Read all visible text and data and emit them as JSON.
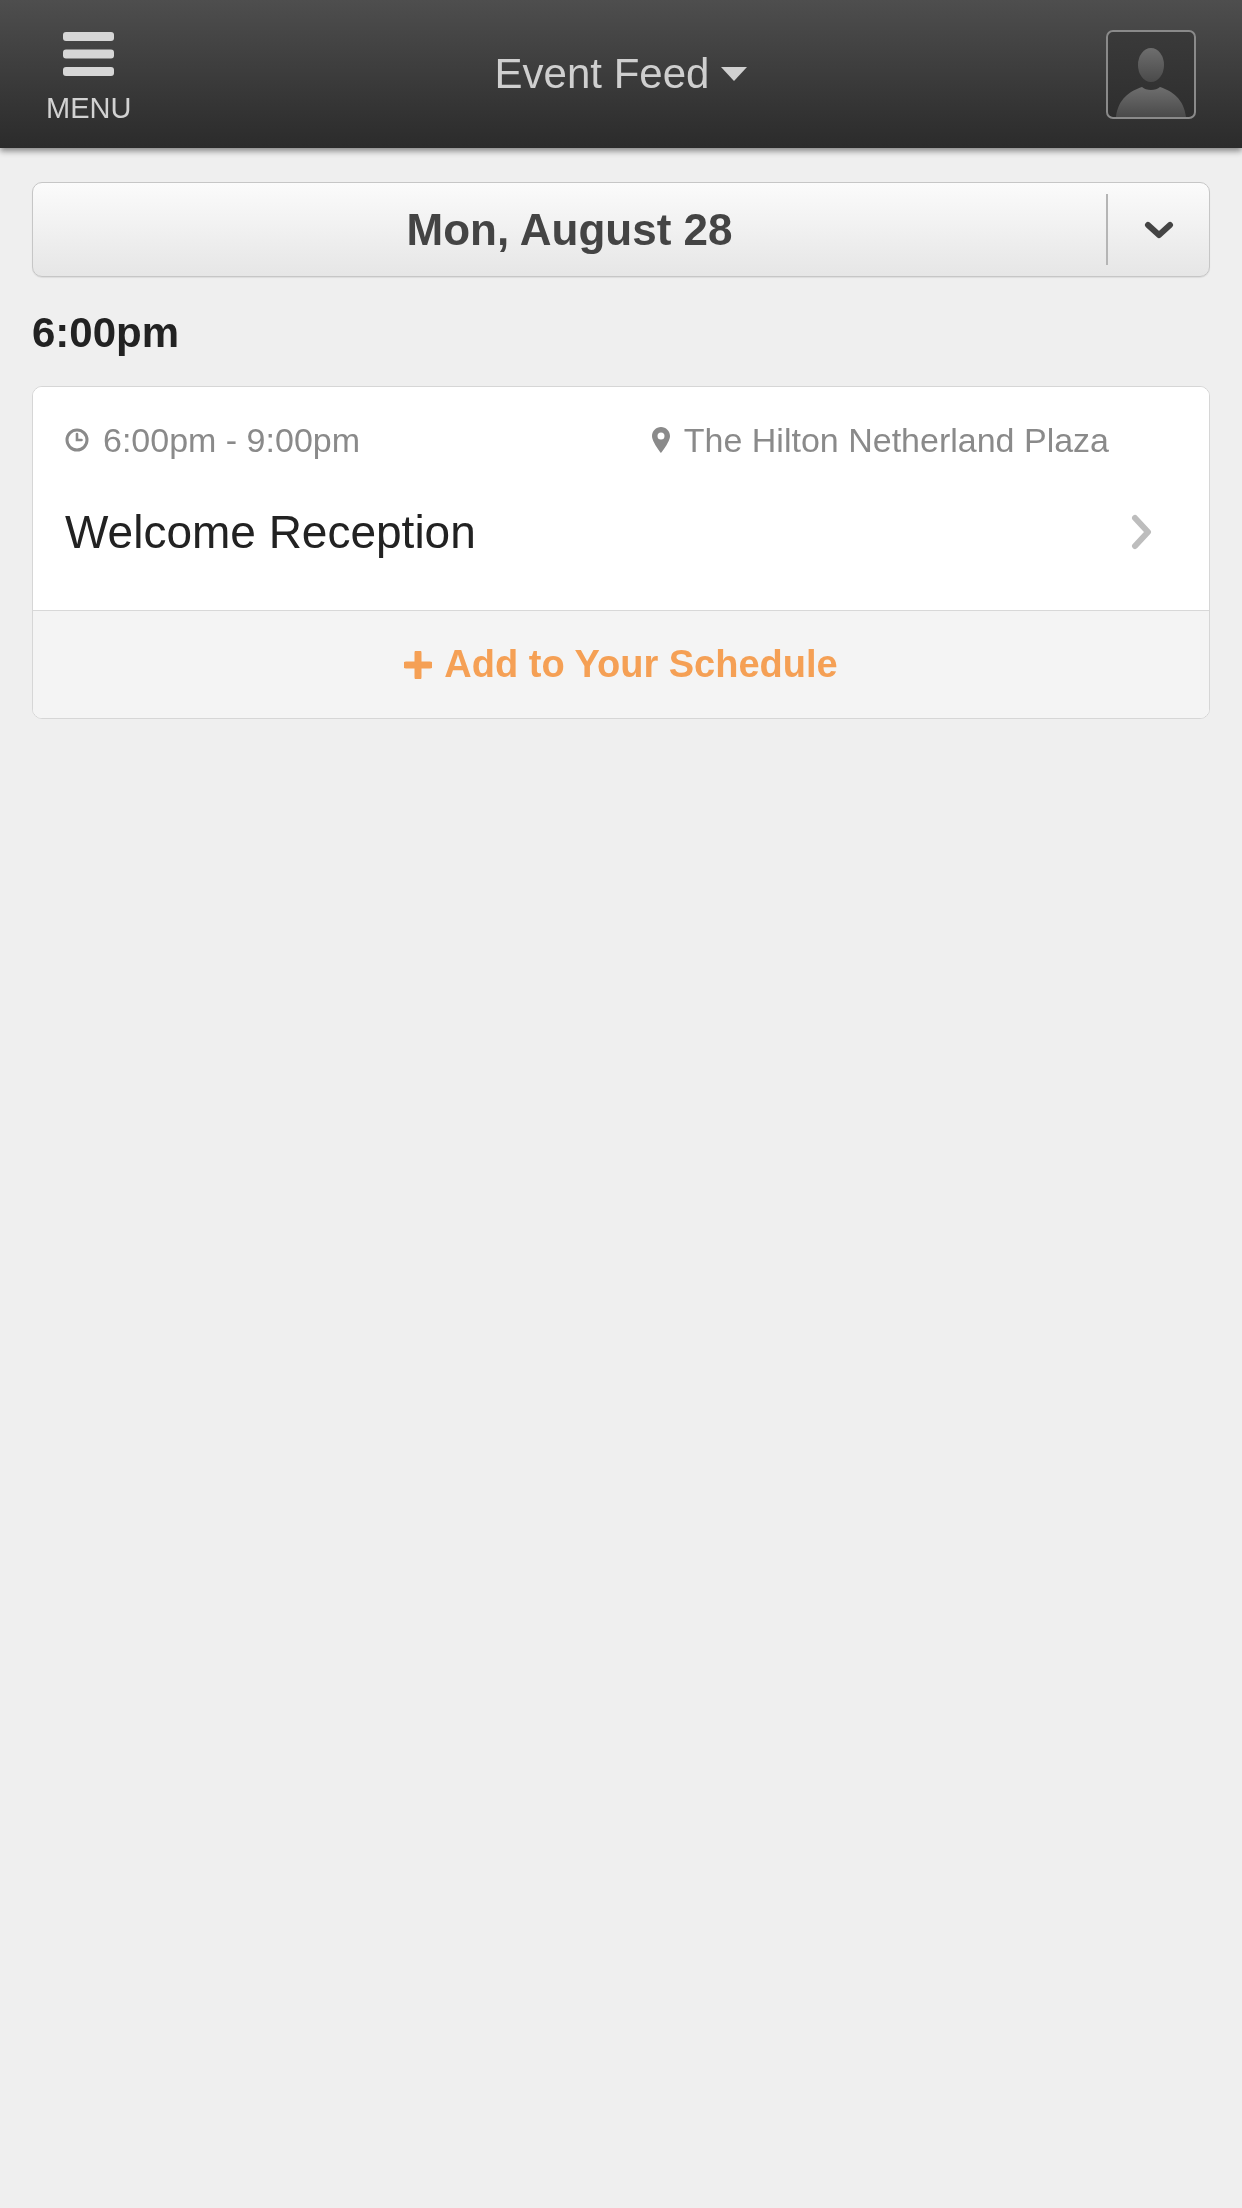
{
  "header": {
    "menu_label": "MENU",
    "title": "Event Feed"
  },
  "date_selector": {
    "value": "Mon, August 28"
  },
  "time_groups": [
    {
      "time": "6:00pm",
      "events": [
        {
          "time_range": "6:00pm - 9:00pm",
          "location": "The Hilton Netherland Plaza",
          "title": "Welcome Reception",
          "action": "Add to Your Schedule"
        }
      ]
    }
  ]
}
